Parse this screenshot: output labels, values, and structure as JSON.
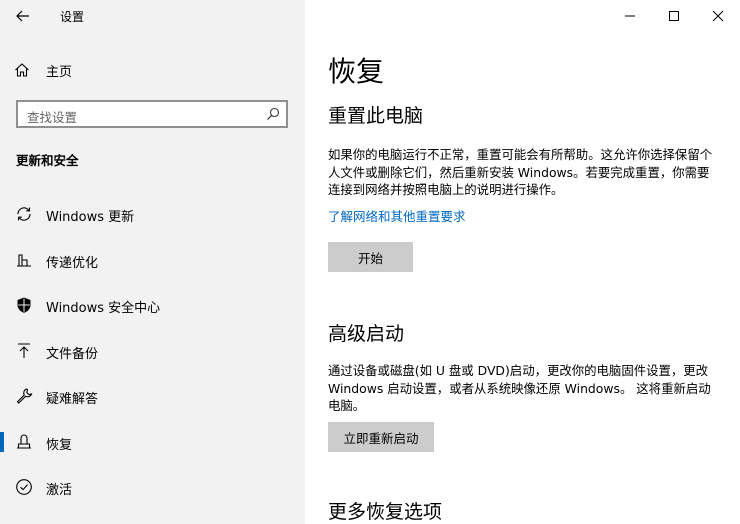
{
  "window": {
    "title": "设置"
  },
  "sidebar": {
    "home_label": "主页",
    "search_placeholder": "查找设置",
    "section_title": "更新和安全",
    "items": [
      {
        "label": "Windows 更新",
        "icon": "sync-icon"
      },
      {
        "label": "传递优化",
        "icon": "delivery-optimization-icon"
      },
      {
        "label": "Windows 安全中心",
        "icon": "shield-icon"
      },
      {
        "label": "文件备份",
        "icon": "backup-arrow-icon"
      },
      {
        "label": "疑难解答",
        "icon": "wrench-icon"
      },
      {
        "label": "恢复",
        "icon": "recovery-icon",
        "active": true
      },
      {
        "label": "激活",
        "icon": "check-circle-icon"
      }
    ]
  },
  "main": {
    "title": "恢复",
    "reset": {
      "heading": "重置此电脑",
      "description": "如果你的电脑运行不正常，重置可能会有所帮助。这允许你选择保留个人文件或删除它们，然后重新安装 Windows。若要完成重置，你需要连接到网络并按照电脑上的说明进行操作。",
      "link": "了解网络和其他重置要求",
      "button": "开始"
    },
    "advanced": {
      "heading": "高级启动",
      "description": "通过设备或磁盘(如 U 盘或 DVD)启动，更改你的电脑固件设置，更改 Windows 启动设置，或者从系统映像还原 Windows。 这将重新启动电脑。",
      "button": "立即重新启动"
    },
    "more": {
      "heading": "更多恢复选项"
    }
  },
  "colors": {
    "accent": "#0067c0",
    "sidebar_bg": "#f2f2f2",
    "button_bg": "#cccccc"
  }
}
